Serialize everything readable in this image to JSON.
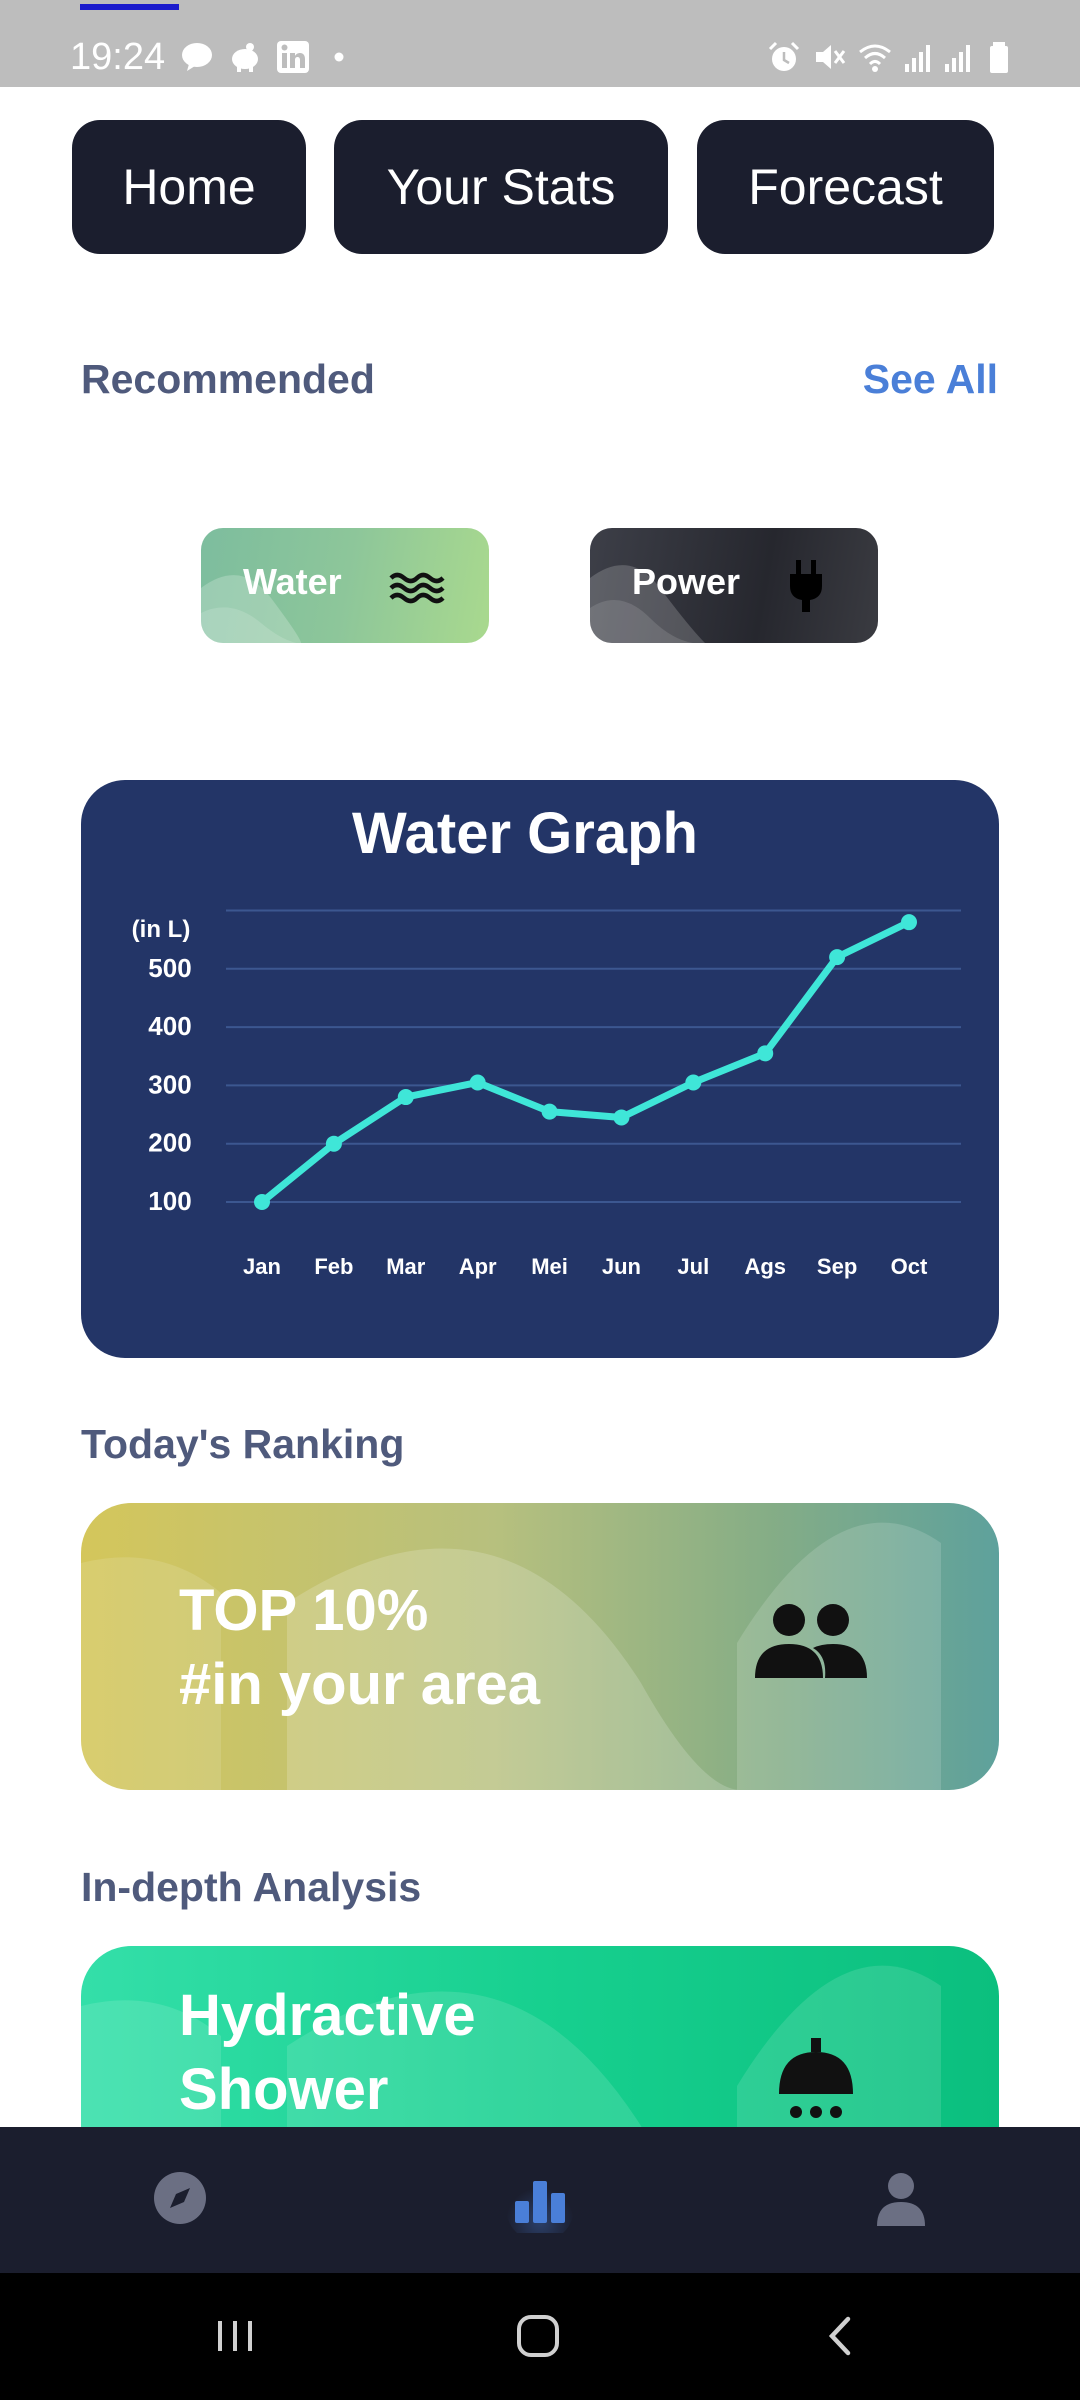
{
  "status_bar": {
    "time": "19:24",
    "icons_left": [
      "talk-icon",
      "piggy-bank-icon",
      "linkedin-icon",
      "dot-icon"
    ],
    "icons_right": [
      "alarm-icon",
      "mute-icon",
      "wifi-icon",
      "signal-icon",
      "signal-icon",
      "battery-icon"
    ]
  },
  "tabs": [
    {
      "label": "Home"
    },
    {
      "label": "Your Stats"
    },
    {
      "label": "Forecast"
    }
  ],
  "recommended": {
    "title": "Recommended",
    "see_all": "See All",
    "items": [
      {
        "label": "Water",
        "icon": "water-waves-icon"
      },
      {
        "label": "Power",
        "icon": "power-plug-icon"
      }
    ]
  },
  "chart_data": {
    "type": "line",
    "title": "Water Graph",
    "ylabel": "(in L)",
    "categories": [
      "Jan",
      "Feb",
      "Mar",
      "Apr",
      "Mei",
      "Jun",
      "Jul",
      "Ags",
      "Sep",
      "Oct"
    ],
    "series": [
      {
        "values": [
          100,
          200,
          280,
          305,
          255,
          245,
          305,
          355,
          520,
          580
        ]
      }
    ],
    "yticks": [
      100,
      200,
      300,
      400,
      500
    ],
    "ylim": [
      100,
      600
    ],
    "grid": true,
    "colors": {
      "line": "#3fe6d8",
      "background": "#233567",
      "grid": "#3c5790",
      "text": "#ffffff"
    }
  },
  "ranking": {
    "title": "Today's Ranking",
    "line1": "TOP 10%",
    "line2": "#in your area",
    "icon": "people-group-icon"
  },
  "analysis": {
    "title": "In-depth Analysis",
    "line1": "Hydractive",
    "line2": "Shower",
    "icon": "shower-head-icon"
  },
  "bottom_nav": [
    {
      "name": "explore",
      "icon": "compass-icon",
      "active": false
    },
    {
      "name": "stats",
      "icon": "bar-chart-icon",
      "active": true
    },
    {
      "name": "profile",
      "icon": "person-icon",
      "active": false
    }
  ],
  "system_nav": [
    "recent-apps-icon",
    "home-icon",
    "back-icon"
  ]
}
